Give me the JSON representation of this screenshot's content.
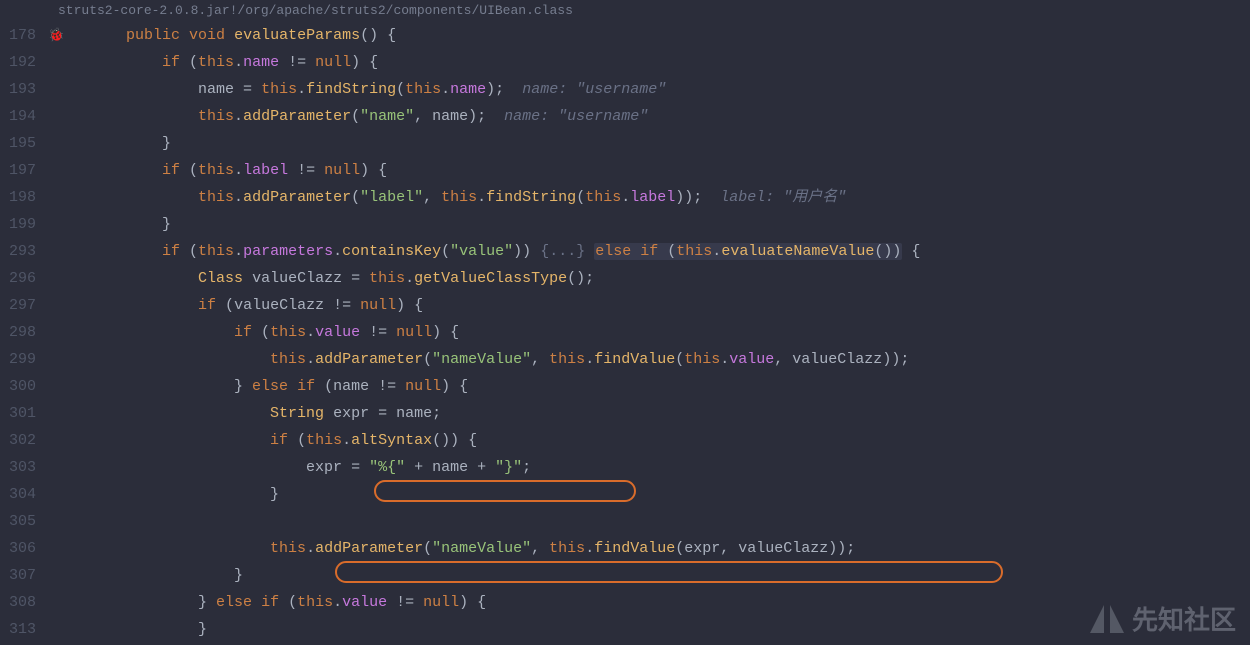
{
  "breadcrumb": "struts2-core-2.0.8.jar!/org/apache/struts2/components/UIBean.class",
  "gutter": [
    "178",
    "192",
    "193",
    "194",
    "195",
    "197",
    "198",
    "199",
    "293",
    "296",
    "297",
    "298",
    "299",
    "300",
    "301",
    "302",
    "303",
    "304",
    "305",
    "306",
    "307",
    "308",
    "313"
  ],
  "tokens": {
    "public": "public",
    "void": "void",
    "evaluateParams": "evaluateParams",
    "if": "if",
    "this": "this",
    "name": "name",
    "null": "null",
    "findString": "findString",
    "addParameter": "addParameter",
    "cmt_name": "name: \"username\"",
    "label": "label",
    "str_name": "\"name\"",
    "str_label": "\"label\"",
    "cmt_label": "label: \"用户名\"",
    "parameters": "parameters",
    "containsKey": "containsKey",
    "str_value": "\"value\"",
    "fold": "{...}",
    "else": "else",
    "evaluateNameValue": "evaluateNameValue",
    "Class": "Class",
    "valueClazz": "valueClazz",
    "getValueClassType": "getValueClassType",
    "value": "value",
    "str_nameValue": "\"nameValue\"",
    "findValue": "findValue",
    "String": "String",
    "expr": "expr",
    "altSyntax": "altSyntax",
    "str_pct": "\"%{\"",
    "str_brace": "\"}\""
  },
  "watermark": "先知社区"
}
